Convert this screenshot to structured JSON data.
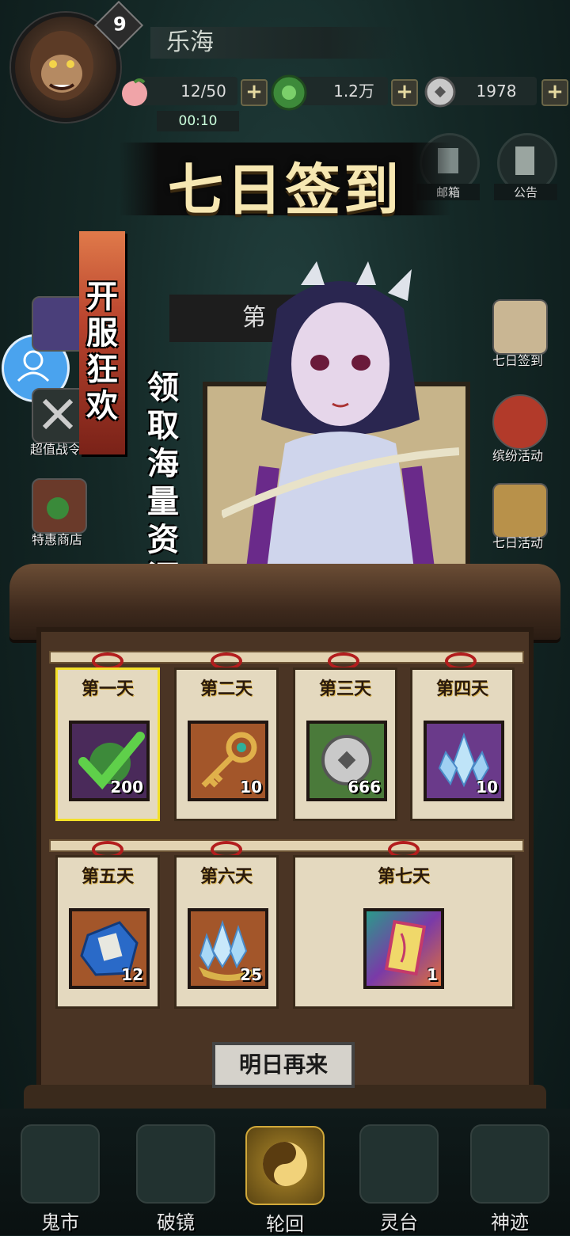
{
  "player": {
    "level": "9",
    "name": "乐海"
  },
  "resources": [
    {
      "icon": "peach-icon",
      "value": "12/50"
    },
    {
      "icon": "jade-coin-icon",
      "value": "1.2万"
    },
    {
      "icon": "silver-coin-icon",
      "value": "1978"
    }
  ],
  "timer": "00:10",
  "top_buttons": {
    "mail": "邮箱",
    "notice": "公告"
  },
  "dialog": {
    "title": "七日签到",
    "banner": "开服狂欢",
    "slogan": "领取海量资源",
    "day_tab_fragment": "第",
    "days": [
      {
        "label": "第一天",
        "qty": "200",
        "icon": "checkmark-icon",
        "claimed": true
      },
      {
        "label": "第二天",
        "qty": "10",
        "icon": "key-icon"
      },
      {
        "label": "第三天",
        "qty": "666",
        "icon": "silver-coin-icon"
      },
      {
        "label": "第四天",
        "qty": "10",
        "icon": "crystal-icon"
      },
      {
        "label": "第五天",
        "qty": "12",
        "icon": "blue-stone-icon"
      },
      {
        "label": "第六天",
        "qty": "25",
        "icon": "crystal-basket-icon"
      },
      {
        "label": "第七天",
        "qty": "1",
        "icon": "talisman-card-icon"
      }
    ],
    "button": "明日再来"
  },
  "side_left": [
    {
      "label": "超值战令",
      "icon": "crossed-swords-icon"
    },
    {
      "label": "特惠商店",
      "icon": "shop-icon"
    }
  ],
  "side_right": [
    {
      "label": "七日签到",
      "icon": "scroll-icon"
    },
    {
      "label": "缤纷活动",
      "icon": "drum-icon"
    },
    {
      "label": "七日活动",
      "icon": "bamboo-scroll-icon"
    }
  ],
  "bottom_nav": [
    {
      "label": "鬼市",
      "icon": "market-icon"
    },
    {
      "label": "破镜",
      "icon": "mirror-icon"
    },
    {
      "label": "轮回",
      "icon": "yin-yang-icon"
    },
    {
      "label": "灵台",
      "icon": "pavilion-icon"
    },
    {
      "label": "神迹",
      "icon": "shrine-icon"
    }
  ]
}
